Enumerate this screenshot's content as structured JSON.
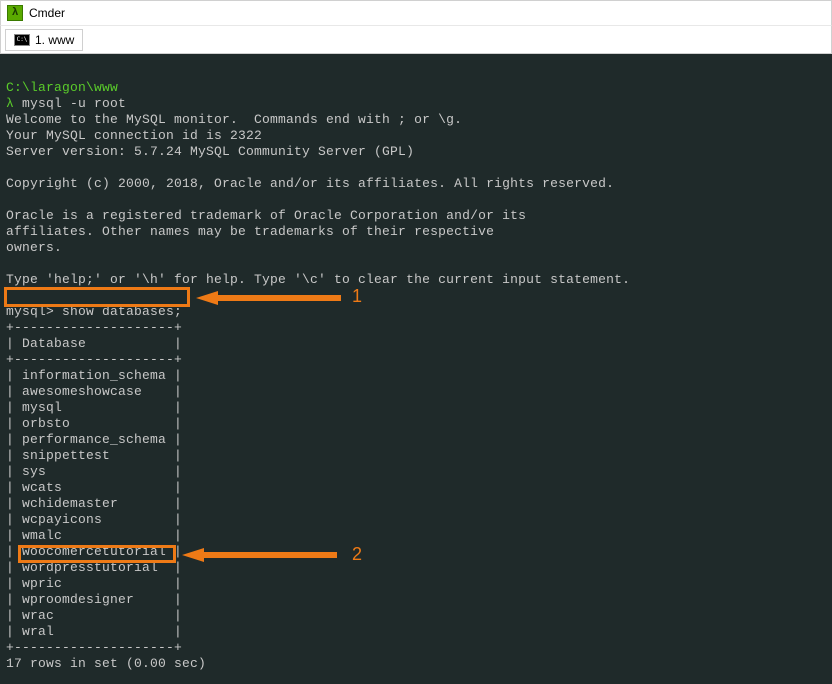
{
  "window": {
    "title": "Cmder"
  },
  "tabs": {
    "active": "1. www"
  },
  "terminal": {
    "prompt_path": "C:\\laragon\\www",
    "prompt_symbol": "λ",
    "command1": "mysql -u root",
    "welcome_line1": "Welcome to the MySQL monitor.  Commands end with ; or \\g.",
    "welcome_line2": "Your MySQL connection id is 2322",
    "welcome_line3": "Server version: 5.7.24 MySQL Community Server (GPL)",
    "copyright": "Copyright (c) 2000, 2018, Oracle and/or its affiliates. All rights reserved.",
    "trademark1": "Oracle is a registered trademark of Oracle Corporation and/or its",
    "trademark2": "affiliates. Other names may be trademarks of their respective",
    "trademark3": "owners.",
    "help_line": "Type 'help;' or '\\h' for help. Type '\\c' to clear the current input statement.",
    "mysql_prompt": "mysql>",
    "command2": "show databases;",
    "table_sep": "+--------------------+",
    "table_header": "| Database           |",
    "databases": [
      "| information_schema |",
      "| awesomeshowcase    |",
      "| mysql              |",
      "| orbsto             |",
      "| performance_schema |",
      "| snippettest        |",
      "| sys                |",
      "| wcats              |",
      "| wchidemaster       |",
      "| wcpayicons         |",
      "| wmalc              |",
      "| woocomercetutorial |",
      "| wordpresstutorial  |",
      "| wpric              |",
      "| wproomdesigner     |",
      "| wrac               |",
      "| wral               |"
    ],
    "result": "17 rows in set (0.00 sec)"
  },
  "annotations": {
    "num1": "1",
    "num2": "2"
  }
}
